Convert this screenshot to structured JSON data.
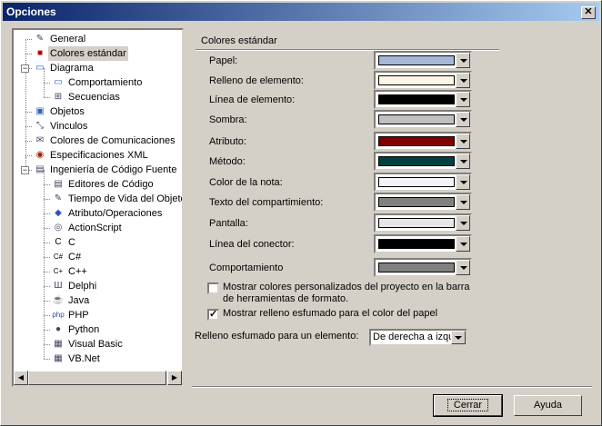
{
  "window": {
    "title": "Opciones",
    "close": "✕"
  },
  "tree": {
    "items": [
      {
        "label": "General",
        "icon": "general-icon"
      },
      {
        "label": "Colores estándar",
        "icon": "colors-icon"
      },
      {
        "label": "Diagrama",
        "icon": "diagram-icon"
      },
      {
        "label": "Comportamiento",
        "icon": "behavior-icon"
      },
      {
        "label": "Secuencias",
        "icon": "sequence-icon"
      },
      {
        "label": "Objetos",
        "icon": "objects-icon"
      },
      {
        "label": "Vinculos",
        "icon": "links-icon"
      },
      {
        "label": "Colores de Comunicaciones",
        "icon": "communications-icon"
      },
      {
        "label": "Especificaciones XML",
        "icon": "xml-icon"
      },
      {
        "label": "Ingeniería de Código Fuente",
        "icon": "source-code-icon"
      },
      {
        "label": "Editores de Código",
        "icon": "code-editor-icon"
      },
      {
        "label": "Tiempo de Vida del Objeto",
        "icon": "lifetime-icon"
      },
      {
        "label": "Atributo/Operaciones",
        "icon": "attribute-icon"
      },
      {
        "label": "ActionScript",
        "icon": "actionscript-icon"
      },
      {
        "label": "C",
        "icon": "c-icon"
      },
      {
        "label": "C#",
        "icon": "csharp-icon"
      },
      {
        "label": "C++",
        "icon": "cpp-icon"
      },
      {
        "label": "Delphi",
        "icon": "delphi-icon"
      },
      {
        "label": "Java",
        "icon": "java-icon"
      },
      {
        "label": "PHP",
        "icon": "php-icon"
      },
      {
        "label": "Python",
        "icon": "python-icon"
      },
      {
        "label": "Visual Basic",
        "icon": "vb-icon"
      },
      {
        "label": "VB.Net",
        "icon": "vbnet-icon"
      }
    ],
    "selected": "Colores estándar"
  },
  "section_title": "Colores estándar",
  "colors": [
    {
      "label": "Papel:",
      "color": "#a6b8d8"
    },
    {
      "label": "Relleno de elemento:",
      "color": "#fdf6e6"
    },
    {
      "label": "Línea de elemento:",
      "color": "#000000"
    },
    {
      "label": "Sombra:",
      "color": "#c0c0c0"
    },
    {
      "label": "Atributo:",
      "color": "#800000"
    },
    {
      "label": "Método:",
      "color": "#004040"
    },
    {
      "label": "Color de la nota:",
      "color": "#f4f4f8"
    },
    {
      "label": "Texto del compartimiento:",
      "color": "#808080"
    },
    {
      "label": "Pantalla:",
      "color": "#e6e6e6"
    },
    {
      "label": "Línea del conector:",
      "color": "#000000"
    },
    {
      "label": "Comportamiento",
      "color": "#808080"
    }
  ],
  "checkboxes": [
    {
      "label_line1": "Mostrar colores personalizados del proyecto en la barra",
      "label_line2": "de herramientas de formato.",
      "checked": false
    },
    {
      "label_line1": "Mostrar relleno esfumado para el color del papel",
      "label_line2": "",
      "checked": true
    }
  ],
  "gradient": {
    "label": "Relleno esfumado para un elemento:",
    "value": "De derecha a izquierda"
  },
  "buttons": {
    "close": "Cerrar",
    "help": "Ayuda"
  }
}
